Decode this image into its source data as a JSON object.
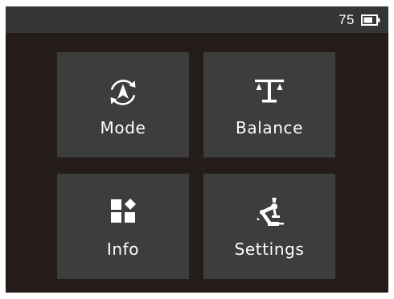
{
  "status_bar": {
    "battery_level": "75",
    "battery_fill": 0.75,
    "battery_icon": "battery-icon"
  },
  "menu": {
    "tiles": [
      {
        "label": "Mode",
        "icon": "compass-rotate-icon"
      },
      {
        "label": "Balance",
        "icon": "balance-scale-icon"
      },
      {
        "label": "Info",
        "icon": "grid-blocks-icon"
      },
      {
        "label": "Settings",
        "icon": "robot-arm-icon"
      }
    ]
  },
  "colors": {
    "background": "#231c19",
    "status_bar": "#353535",
    "tile": "#3d3d3d",
    "text": "#ffffff"
  }
}
